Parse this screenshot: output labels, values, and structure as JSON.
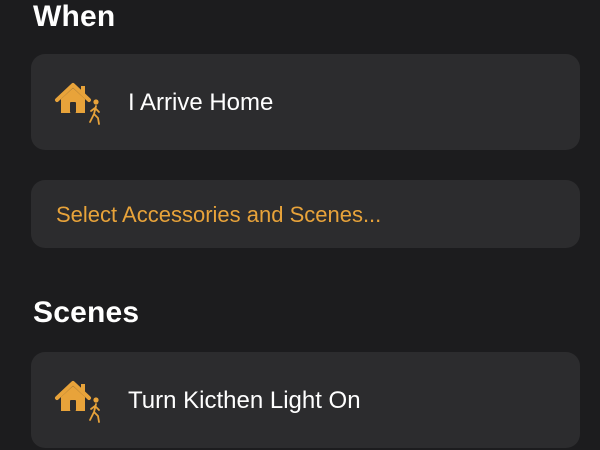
{
  "sections": {
    "when": {
      "title": "When",
      "trigger": {
        "label": "I Arrive Home",
        "icon": "home-arrive-icon"
      },
      "select_link": "Select Accessories and Scenes..."
    },
    "scenes": {
      "title": "Scenes",
      "items": [
        {
          "label": "Turn Kicthen Light On",
          "icon": "home-arrive-icon"
        }
      ]
    }
  },
  "colors": {
    "background": "#1c1c1e",
    "card": "#2c2c2e",
    "accent": "#e8a33a",
    "text": "#ffffff"
  }
}
